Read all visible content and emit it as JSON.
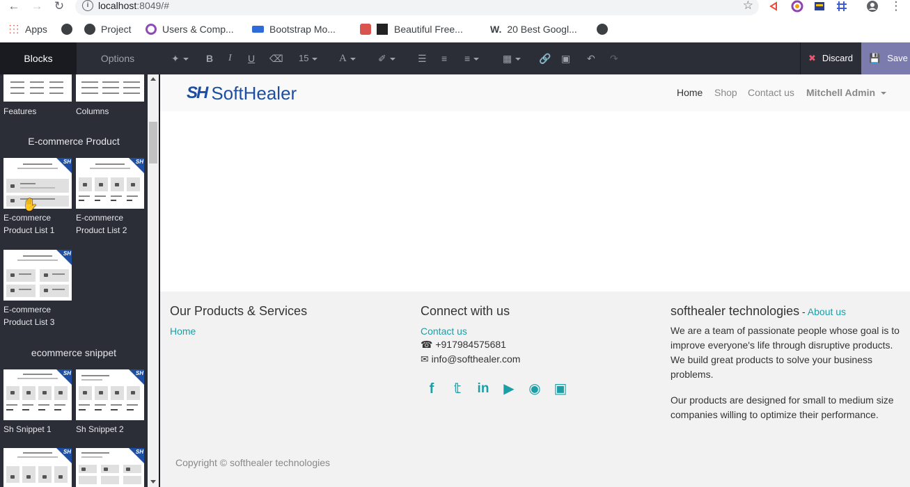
{
  "browser": {
    "url_host": "localhost",
    "url_port": ":8049/#",
    "bookmarks": [
      {
        "label": "Apps",
        "color": "#4285f4"
      },
      {
        "label": "",
        "color": "#3c4043"
      },
      {
        "label": "Project",
        "color": "#3c4043"
      },
      {
        "label": "Users & Comp...",
        "color": "#8e4bb6"
      },
      {
        "label": "Bootstrap Mo...",
        "color": "#2f6bd8"
      },
      {
        "label": "Beautiful Free...",
        "color": "#d9534f"
      },
      {
        "label": "20 Best Googl...",
        "color": "#222222"
      },
      {
        "label": "",
        "color": "#3c4043"
      }
    ]
  },
  "editor": {
    "tab_blocks": "Blocks",
    "tab_options": "Options",
    "font_size": "15",
    "discard_label": "Discard",
    "save_label": "Save"
  },
  "sidebar": {
    "top_blocks": [
      {
        "label": "Features"
      },
      {
        "label": "Columns"
      }
    ],
    "categories": [
      {
        "title": "E-commerce Product",
        "blocks": [
          {
            "label": "E-commerce Product List 1"
          },
          {
            "label": "E-commerce Product List 2"
          },
          {
            "label": "E-commerce Product List 3"
          }
        ]
      },
      {
        "title": "ecommerce snippet",
        "blocks": [
          {
            "label": "Sh Snippet 1"
          },
          {
            "label": "Sh Snippet 2"
          }
        ]
      }
    ],
    "badge": "SH"
  },
  "site": {
    "logo_mark": "SH",
    "logo_text": "SoftHealer",
    "nav": [
      {
        "label": "Home",
        "active": true
      },
      {
        "label": "Shop",
        "active": false
      },
      {
        "label": "Contact us",
        "active": false
      }
    ],
    "user": "Mitchell Admin",
    "footer": {
      "col1_title": "Our Products & Services",
      "col1_link": "Home",
      "col2_title": "Connect with us",
      "col2_link": "Contact us",
      "phone": "+917984575681",
      "email": "info@softhealer.com",
      "col3_title": "softhealer technologies",
      "col3_title_sep": " - ",
      "col3_link": "About us",
      "about_p1": "We are a team of passionate people whose goal is to improve everyone's life through disruptive products. We build great products to solve your business problems.",
      "about_p2": "Our products are designed for small to medium size companies willing to optimize their performance.",
      "copyright": "Copyright © softhealer technologies",
      "social": [
        "facebook-icon",
        "twitter-icon",
        "linkedin-icon",
        "youtube-icon",
        "github-icon",
        "instagram-icon"
      ]
    }
  }
}
